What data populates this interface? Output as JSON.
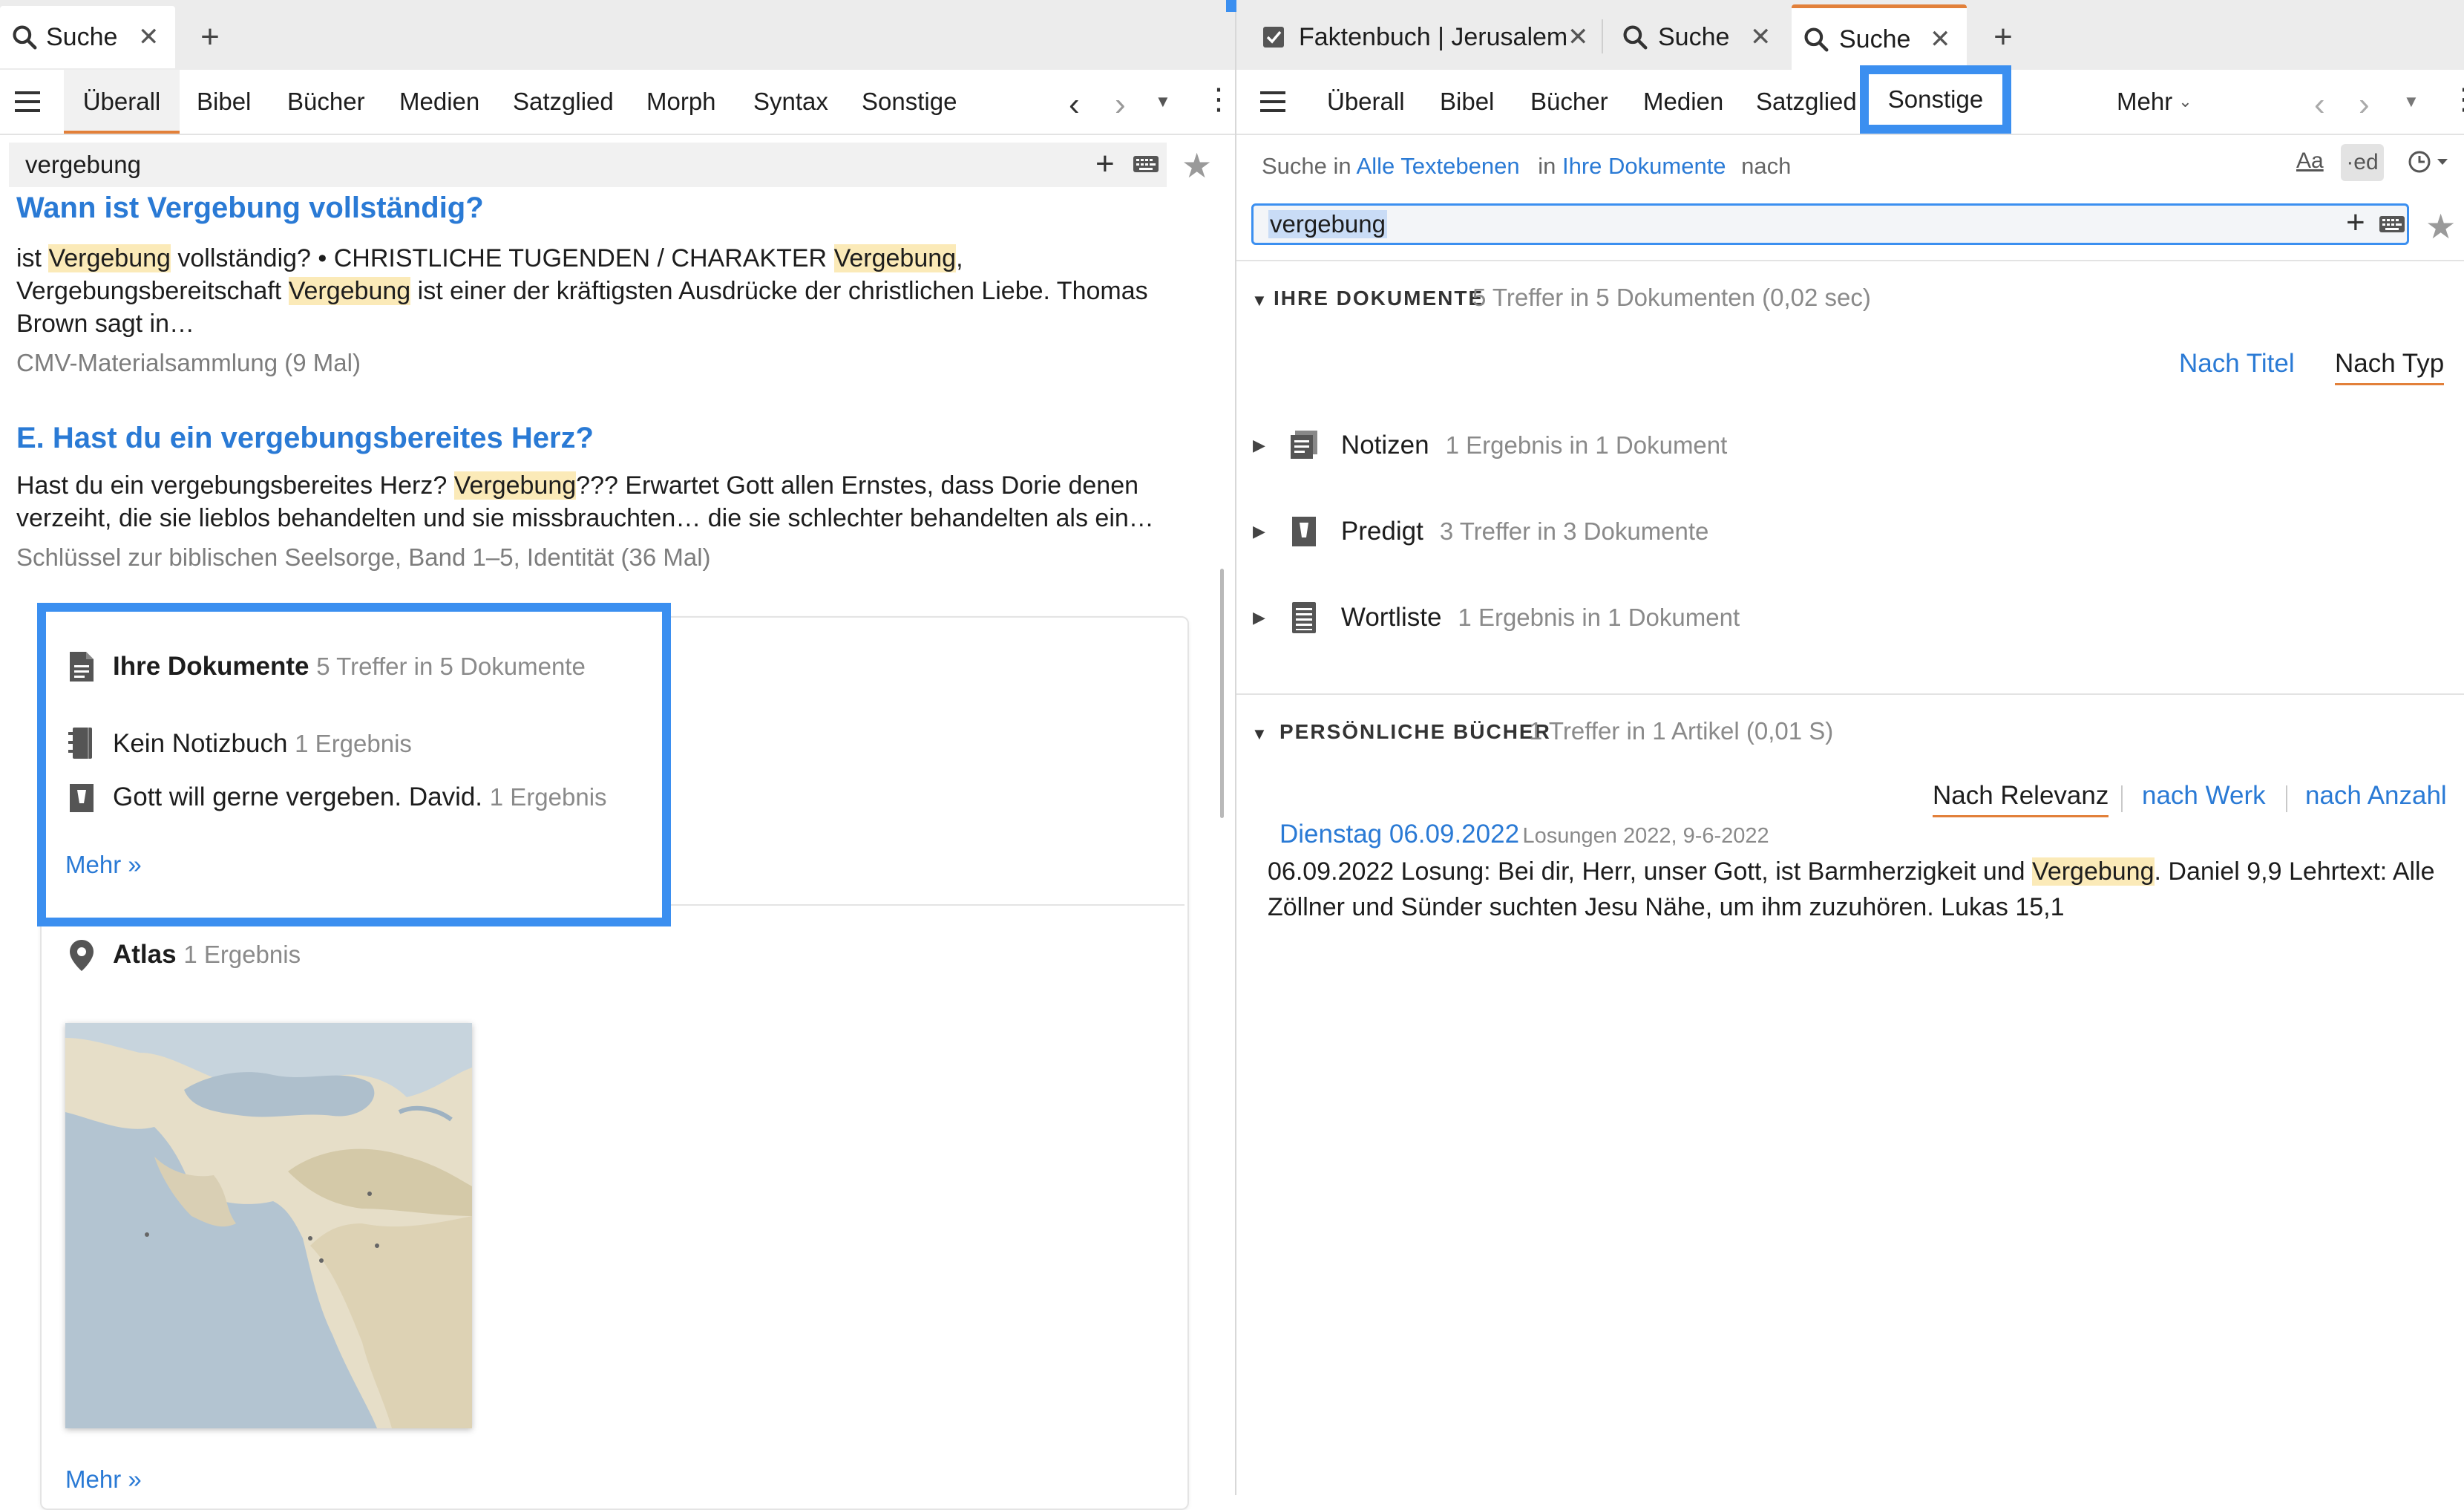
{
  "left_tabs": {
    "search_label": "Suche"
  },
  "left_nav": {
    "items": [
      "Überall",
      "Bibel",
      "Bücher",
      "Medien",
      "Satzglied",
      "Morph",
      "Syntax",
      "Sonstige"
    ]
  },
  "left_search": {
    "value": "vergebung"
  },
  "results": [
    {
      "title": "Wann ist Vergebung vollständig?",
      "line1": [
        "ist ",
        "Vergebung",
        " vollständig? • CHRISTLICHE TUGENDEN / CHARAKTER ",
        "Vergebung",
        ","
      ],
      "line2": [
        "Vergebungsbereitschaft ",
        "Vergebung",
        " ist einer der kräftigsten Ausdrücke der christlichen Liebe. Thomas"
      ],
      "line3": "Brown sagt in…",
      "source": "CMV-Materialsammlung (9 Mal)"
    },
    {
      "title": "E. Hast du ein vergebungsbereites Herz?",
      "line1": [
        "Hast du ein vergebungsbereites Herz? ",
        "Vergebung",
        "??? Erwartet Gott allen Ernstes, dass Dorie denen"
      ],
      "line2": "verzeiht, die sie lieblos behandelten und sie missbrauchten… die sie schlechter behandelten als ein…",
      "source": "Schlüssel zur biblischen Seelsorge, Band 1–5, Identität (36 Mal)"
    }
  ],
  "docs_card": {
    "heading": "Ihre Dokumente",
    "heading_count": "5 Treffer in 5 Dokumente",
    "items": [
      {
        "label": "Kein Notizbuch",
        "count": "1 Ergebnis"
      },
      {
        "label": "Gott will gerne vergeben. David.",
        "count": "1 Ergebnis"
      }
    ],
    "more": "Mehr »"
  },
  "atlas_card": {
    "heading": "Atlas",
    "count": "1 Ergebnis",
    "more": "Mehr »"
  },
  "right_tabs": {
    "tab1": "Faktenbuch | Jerusalem",
    "tab2": "Suche",
    "tab3": "Suche"
  },
  "right_nav": {
    "items": [
      "Überall",
      "Bibel",
      "Bücher",
      "Medien",
      "Satzglied",
      "Sonstige"
    ],
    "more": "Mehr"
  },
  "scope": {
    "prefix": "Suche in",
    "layers": "Alle Textebenen",
    "in": "in",
    "docs": "Ihre Dokumente",
    "suffix": "nach",
    "case_btn": "Aa",
    "stem_btn": "·ed"
  },
  "right_search": {
    "value": "vergebung"
  },
  "ihre_dokumente": {
    "heading": "IHRE DOKUMENTE",
    "summary": "5 Treffer in 5 Dokumenten (0,02 sec)",
    "sort_title": "Nach Titel",
    "sort_type": "Nach Typ",
    "types": [
      {
        "label": "Notizen",
        "count": "1 Ergebnis in 1 Dokument"
      },
      {
        "label": "Predigt",
        "count": "3 Treffer in 3 Dokumente"
      },
      {
        "label": "Wortliste",
        "count": "1 Ergebnis in 1 Dokument"
      }
    ]
  },
  "persoenliche": {
    "heading": "PERSÖNLICHE BÜCHER",
    "summary": "1 Treffer in 1 Artikel (0,01 S)",
    "sort_relevance": "Nach Relevanz",
    "sort_work": "nach Werk",
    "sort_count": "nach Anzahl",
    "entry_title": "Dienstag 06.09.2022",
    "entry_source": "Losungen 2022, 9-6-2022",
    "entry_line1": [
      "06.09.2022 Losung: Bei dir, Herr, unser Gott, ist Barmherzigkeit und ",
      "Vergebung",
      ". Daniel 9,9  Lehrtext: Alle"
    ],
    "entry_line2": "Zöllner und Sünder suchten Jesu Nähe, um ihm zuzuhören. Lukas 15,1"
  },
  "colors": {
    "highlight": "#fbeab8",
    "link": "#2a7ad5",
    "accent_tab": "#e2803a",
    "focus_box": "#3b8ff0"
  }
}
